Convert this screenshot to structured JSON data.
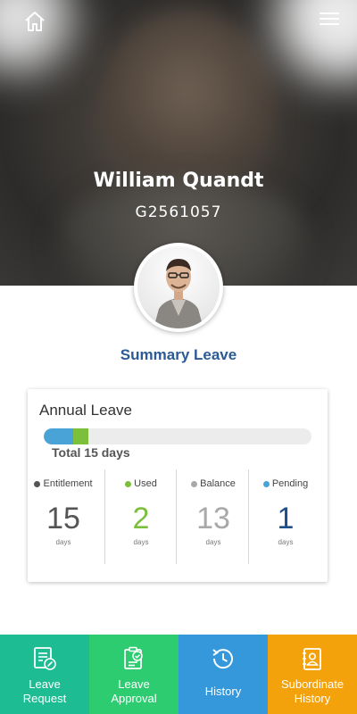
{
  "profile": {
    "name": "William Quandt",
    "employee_id": "G2561057"
  },
  "header": {
    "home_icon": "home-icon",
    "menu_icon": "hamburger-menu-icon"
  },
  "summary": {
    "title": "Summary Leave"
  },
  "annual_leave": {
    "title": "Annual Leave",
    "total_label": "Total 15 days",
    "progress": {
      "used_fraction": 0.067,
      "pending_fraction": 0.067
    },
    "stats": [
      {
        "label": "Entitlement",
        "value": "15",
        "unit": "days",
        "color": "#555555",
        "dot_color": "#555555"
      },
      {
        "label": "Used",
        "value": "2",
        "unit": "days",
        "color": "#7cbf3a",
        "dot_color": "#7cbf3a"
      },
      {
        "label": "Balance",
        "value": "13",
        "unit": "days",
        "color": "#a9a9a9",
        "dot_color": "#a9a9a9"
      },
      {
        "label": "Pending",
        "value": "1",
        "unit": "days",
        "color": "#1f4f8a",
        "dot_color": "#4aa3d6"
      }
    ]
  },
  "tabs": [
    {
      "label": "Leave\nRequest",
      "icon": "leave-request-icon",
      "color": "#1ebc93"
    },
    {
      "label": "Leave\nApproval",
      "icon": "leave-approval-icon",
      "color": "#2ecc71"
    },
    {
      "label": "History",
      "icon": "history-icon",
      "color": "#3498db"
    },
    {
      "label": "Subordinate\nHistory",
      "icon": "subordinate-history-icon",
      "color": "#f3a20b"
    }
  ],
  "colors": {
    "accent": "#2b5a94",
    "bar_used": "#4aa3d6",
    "bar_pending": "#7cbf3a"
  }
}
